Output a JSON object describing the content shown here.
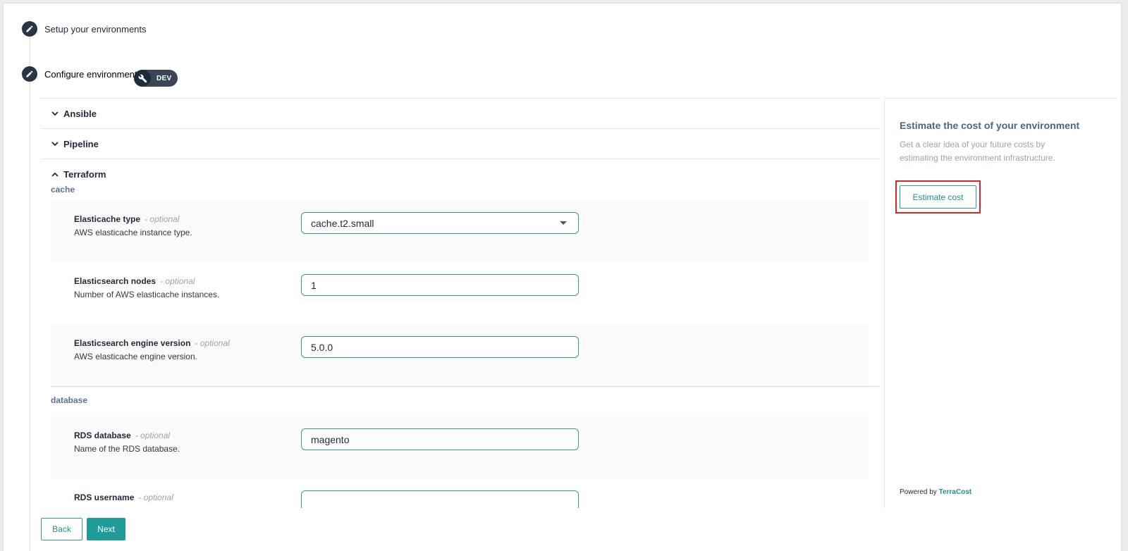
{
  "steps": {
    "setup_label": "Setup your environments",
    "configure_label": "Configure environment:",
    "env_chip": "DEV"
  },
  "accordion": {
    "ansible": "Ansible",
    "pipeline": "Pipeline",
    "terraform": "Terraform"
  },
  "sections": {
    "cache": {
      "label": "cache",
      "fields": [
        {
          "name": "Elasticache type",
          "optional": "- optional",
          "description": "AWS elasticache instance type.",
          "value": "cache.t2.small"
        },
        {
          "name": "Elasticsearch nodes",
          "optional": "- optional",
          "description": "Number of AWS elasticache instances.",
          "value": "1"
        },
        {
          "name": "Elasticsearch engine version",
          "optional": "- optional",
          "description": "AWS elasticache engine version.",
          "value": "5.0.0"
        }
      ]
    },
    "database": {
      "label": "database",
      "fields": [
        {
          "name": "RDS database",
          "optional": "- optional",
          "description": "Name of the RDS database.",
          "value": "magento"
        },
        {
          "name": "RDS username",
          "optional": "- optional",
          "description": "",
          "value": ""
        }
      ]
    }
  },
  "cost_panel": {
    "title": "Estimate the cost of your environment",
    "description": "Get a clear idea of your future costs by estimating the environment infrastructure.",
    "button": "Estimate cost",
    "powered_by": "Powered by",
    "brand": "TerraCost"
  },
  "footer": {
    "back": "Back",
    "next": "Next"
  },
  "colors": {
    "accent": "#1f9b98",
    "highlight": "#d9262c",
    "dark": "#263544"
  }
}
